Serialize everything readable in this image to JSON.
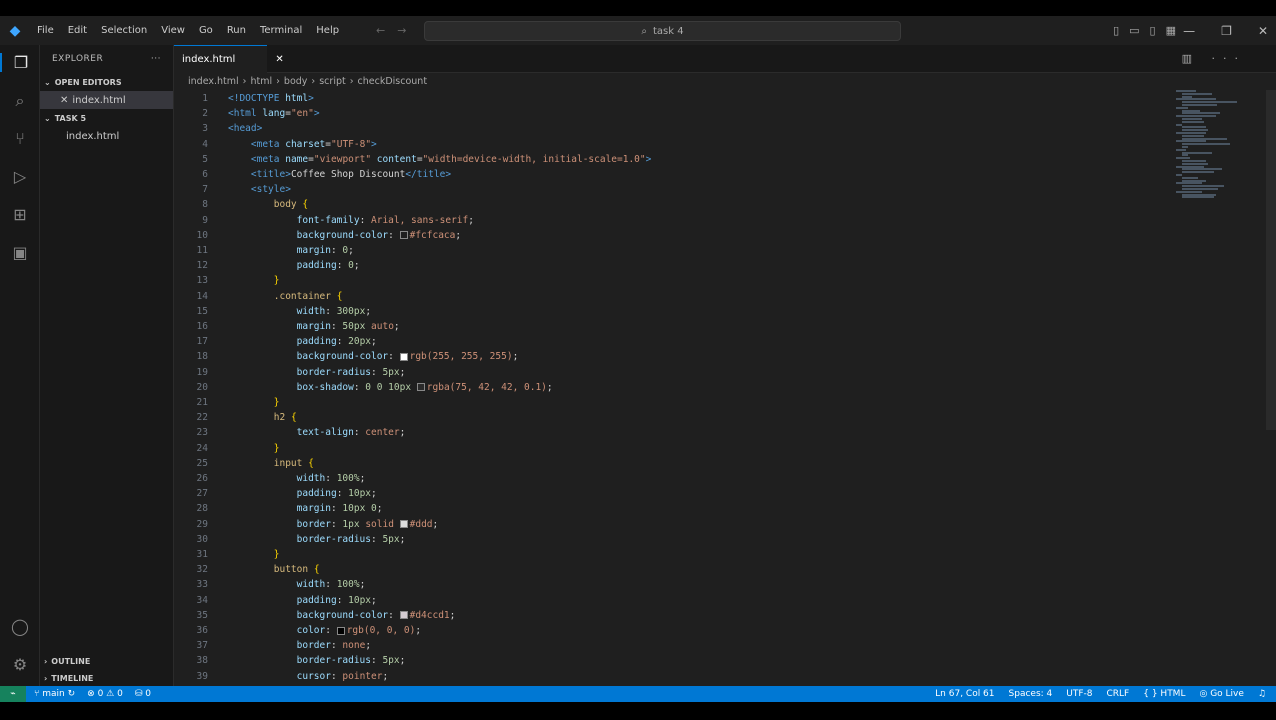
{
  "menu": [
    "File",
    "Edit",
    "Selection",
    "View",
    "Go",
    "Run",
    "Terminal",
    "Help"
  ],
  "search": {
    "text": "task 4"
  },
  "sidebar": {
    "title": "EXPLORER",
    "open_editors_label": "OPEN EDITORS",
    "open_editor_file": "index.html",
    "folder_label": "TASK 5",
    "folder_file": "index.html",
    "outline_label": "OUTLINE",
    "timeline_label": "TIMELINE"
  },
  "tab": {
    "label": "index.html",
    "close": "✕"
  },
  "breadcrumb": [
    "index.html",
    "html",
    "body",
    "script",
    "checkDiscount"
  ],
  "code_lines": [
    {
      "n": "1",
      "parts": [
        [
          "t-tag",
          "<!DOCTYPE "
        ],
        [
          "t-attr",
          "html"
        ],
        [
          "t-tag",
          ">"
        ]
      ]
    },
    {
      "n": "2",
      "parts": [
        [
          "t-tag",
          "<html "
        ],
        [
          "t-attr",
          "lang"
        ],
        [
          "t-punc",
          "="
        ],
        [
          "t-str",
          "\"en\""
        ],
        [
          "t-tag",
          ">"
        ]
      ]
    },
    {
      "n": "3",
      "parts": [
        [
          "t-tag",
          "<head>"
        ]
      ]
    },
    {
      "n": "4",
      "parts": [
        [
          "t-txt",
          "    "
        ],
        [
          "t-tag",
          "<meta "
        ],
        [
          "t-attr",
          "charset"
        ],
        [
          "t-punc",
          "="
        ],
        [
          "t-str",
          "\"UTF-8\""
        ],
        [
          "t-tag",
          ">"
        ]
      ]
    },
    {
      "n": "5",
      "parts": [
        [
          "t-txt",
          "    "
        ],
        [
          "t-tag",
          "<meta "
        ],
        [
          "t-attr",
          "name"
        ],
        [
          "t-punc",
          "="
        ],
        [
          "t-str",
          "\"viewport\" "
        ],
        [
          "t-attr",
          "content"
        ],
        [
          "t-punc",
          "="
        ],
        [
          "t-str",
          "\"width=device-width, initial-scale=1.0\""
        ],
        [
          "t-tag",
          ">"
        ]
      ]
    },
    {
      "n": "6",
      "parts": [
        [
          "t-txt",
          "    "
        ],
        [
          "t-tag",
          "<title>"
        ],
        [
          "t-txt",
          "Coffee Shop Discount"
        ],
        [
          "t-tag",
          "</title>"
        ]
      ]
    },
    {
      "n": "7",
      "parts": [
        [
          "t-txt",
          "    "
        ],
        [
          "t-tag",
          "<style>"
        ]
      ]
    },
    {
      "n": "8",
      "parts": [
        [
          "t-txt",
          "        "
        ],
        [
          "t-sel",
          "body "
        ],
        [
          "t-brk",
          "{"
        ]
      ]
    },
    {
      "n": "9",
      "parts": [
        [
          "t-txt",
          "            "
        ],
        [
          "t-prop",
          "font-family"
        ],
        [
          "t-punc",
          ": "
        ],
        [
          "t-val",
          "Arial, sans-serif"
        ],
        [
          "t-punc",
          ";"
        ]
      ]
    },
    {
      "n": "10",
      "parts": [
        [
          "t-txt",
          "            "
        ],
        [
          "t-prop",
          "background-color"
        ],
        [
          "t-punc",
          ": "
        ],
        [
          "swatch",
          "#fcfcaca"
        ],
        [
          "t-val",
          "#fcfcaca"
        ],
        [
          "t-punc",
          ";"
        ]
      ]
    },
    {
      "n": "11",
      "parts": [
        [
          "t-txt",
          "            "
        ],
        [
          "t-prop",
          "margin"
        ],
        [
          "t-punc",
          ": "
        ],
        [
          "t-num",
          "0"
        ],
        [
          "t-punc",
          ";"
        ]
      ]
    },
    {
      "n": "12",
      "parts": [
        [
          "t-txt",
          "            "
        ],
        [
          "t-prop",
          "padding"
        ],
        [
          "t-punc",
          ": "
        ],
        [
          "t-num",
          "0"
        ],
        [
          "t-punc",
          ";"
        ]
      ]
    },
    {
      "n": "13",
      "parts": [
        [
          "t-txt",
          "        "
        ],
        [
          "t-brk",
          "}"
        ]
      ]
    },
    {
      "n": "14",
      "parts": [
        [
          "t-txt",
          "        "
        ],
        [
          "t-sel",
          ".container "
        ],
        [
          "t-brk",
          "{"
        ]
      ]
    },
    {
      "n": "15",
      "parts": [
        [
          "t-txt",
          "            "
        ],
        [
          "t-prop",
          "width"
        ],
        [
          "t-punc",
          ": "
        ],
        [
          "t-num",
          "300px"
        ],
        [
          "t-punc",
          ";"
        ]
      ]
    },
    {
      "n": "16",
      "parts": [
        [
          "t-txt",
          "            "
        ],
        [
          "t-prop",
          "margin"
        ],
        [
          "t-punc",
          ": "
        ],
        [
          "t-num",
          "50px "
        ],
        [
          "t-val",
          "auto"
        ],
        [
          "t-punc",
          ";"
        ]
      ]
    },
    {
      "n": "17",
      "parts": [
        [
          "t-txt",
          "            "
        ],
        [
          "t-prop",
          "padding"
        ],
        [
          "t-punc",
          ": "
        ],
        [
          "t-num",
          "20px"
        ],
        [
          "t-punc",
          ";"
        ]
      ]
    },
    {
      "n": "18",
      "parts": [
        [
          "t-txt",
          "            "
        ],
        [
          "t-prop",
          "background-color"
        ],
        [
          "t-punc",
          ": "
        ],
        [
          "swatch",
          "#ffffff"
        ],
        [
          "t-val",
          "rgb(255, 255, 255)"
        ],
        [
          "t-punc",
          ";"
        ]
      ]
    },
    {
      "n": "19",
      "parts": [
        [
          "t-txt",
          "            "
        ],
        [
          "t-prop",
          "border-radius"
        ],
        [
          "t-punc",
          ": "
        ],
        [
          "t-num",
          "5px"
        ],
        [
          "t-punc",
          ";"
        ]
      ]
    },
    {
      "n": "20",
      "parts": [
        [
          "t-txt",
          "            "
        ],
        [
          "t-prop",
          "box-shadow"
        ],
        [
          "t-punc",
          ": "
        ],
        [
          "t-num",
          "0 0 10px "
        ],
        [
          "swatch",
          "#2a2a2a"
        ],
        [
          "t-val",
          "rgba(75, 42, 42, 0.1)"
        ],
        [
          "t-punc",
          ";"
        ]
      ]
    },
    {
      "n": "21",
      "parts": [
        [
          "t-txt",
          "        "
        ],
        [
          "t-brk",
          "}"
        ]
      ]
    },
    {
      "n": "22",
      "parts": [
        [
          "t-txt",
          "        "
        ],
        [
          "t-sel",
          "h2 "
        ],
        [
          "t-brk",
          "{"
        ]
      ]
    },
    {
      "n": "23",
      "parts": [
        [
          "t-txt",
          "            "
        ],
        [
          "t-prop",
          "text-align"
        ],
        [
          "t-punc",
          ": "
        ],
        [
          "t-val",
          "center"
        ],
        [
          "t-punc",
          ";"
        ]
      ]
    },
    {
      "n": "24",
      "parts": [
        [
          "t-txt",
          "        "
        ],
        [
          "t-brk",
          "}"
        ]
      ]
    },
    {
      "n": "25",
      "parts": [
        [
          "t-txt",
          "        "
        ],
        [
          "t-sel",
          "input "
        ],
        [
          "t-brk",
          "{"
        ]
      ]
    },
    {
      "n": "26",
      "parts": [
        [
          "t-txt",
          "            "
        ],
        [
          "t-prop",
          "width"
        ],
        [
          "t-punc",
          ": "
        ],
        [
          "t-num",
          "100%"
        ],
        [
          "t-punc",
          ";"
        ]
      ]
    },
    {
      "n": "27",
      "parts": [
        [
          "t-txt",
          "            "
        ],
        [
          "t-prop",
          "padding"
        ],
        [
          "t-punc",
          ": "
        ],
        [
          "t-num",
          "10px"
        ],
        [
          "t-punc",
          ";"
        ]
      ]
    },
    {
      "n": "28",
      "parts": [
        [
          "t-txt",
          "            "
        ],
        [
          "t-prop",
          "margin"
        ],
        [
          "t-punc",
          ": "
        ],
        [
          "t-num",
          "10px 0"
        ],
        [
          "t-punc",
          ";"
        ]
      ]
    },
    {
      "n": "29",
      "parts": [
        [
          "t-txt",
          "            "
        ],
        [
          "t-prop",
          "border"
        ],
        [
          "t-punc",
          ": "
        ],
        [
          "t-num",
          "1px "
        ],
        [
          "t-val",
          "solid "
        ],
        [
          "swatch",
          "#ddd"
        ],
        [
          "t-val",
          "#ddd"
        ],
        [
          "t-punc",
          ";"
        ]
      ]
    },
    {
      "n": "30",
      "parts": [
        [
          "t-txt",
          "            "
        ],
        [
          "t-prop",
          "border-radius"
        ],
        [
          "t-punc",
          ": "
        ],
        [
          "t-num",
          "5px"
        ],
        [
          "t-punc",
          ";"
        ]
      ]
    },
    {
      "n": "31",
      "parts": [
        [
          "t-txt",
          "        "
        ],
        [
          "t-brk",
          "}"
        ]
      ]
    },
    {
      "n": "32",
      "parts": [
        [
          "t-txt",
          "        "
        ],
        [
          "t-sel",
          "button "
        ],
        [
          "t-brk",
          "{"
        ]
      ]
    },
    {
      "n": "33",
      "parts": [
        [
          "t-txt",
          "            "
        ],
        [
          "t-prop",
          "width"
        ],
        [
          "t-punc",
          ": "
        ],
        [
          "t-num",
          "100%"
        ],
        [
          "t-punc",
          ";"
        ]
      ]
    },
    {
      "n": "34",
      "parts": [
        [
          "t-txt",
          "            "
        ],
        [
          "t-prop",
          "padding"
        ],
        [
          "t-punc",
          ": "
        ],
        [
          "t-num",
          "10px"
        ],
        [
          "t-punc",
          ";"
        ]
      ]
    },
    {
      "n": "35",
      "parts": [
        [
          "t-txt",
          "            "
        ],
        [
          "t-prop",
          "background-color"
        ],
        [
          "t-punc",
          ": "
        ],
        [
          "swatch",
          "#d4ccd1"
        ],
        [
          "t-val",
          "#d4ccd1"
        ],
        [
          "t-punc",
          ";"
        ]
      ]
    },
    {
      "n": "36",
      "parts": [
        [
          "t-txt",
          "            "
        ],
        [
          "t-prop",
          "color"
        ],
        [
          "t-punc",
          ": "
        ],
        [
          "swatch",
          "#000000"
        ],
        [
          "t-val",
          "rgb(0, 0, 0)"
        ],
        [
          "t-punc",
          ";"
        ]
      ]
    },
    {
      "n": "37",
      "parts": [
        [
          "t-txt",
          "            "
        ],
        [
          "t-prop",
          "border"
        ],
        [
          "t-punc",
          ": "
        ],
        [
          "t-val",
          "none"
        ],
        [
          "t-punc",
          ";"
        ]
      ]
    },
    {
      "n": "38",
      "parts": [
        [
          "t-txt",
          "            "
        ],
        [
          "t-prop",
          "border-radius"
        ],
        [
          "t-punc",
          ": "
        ],
        [
          "t-num",
          "5px"
        ],
        [
          "t-punc",
          ";"
        ]
      ]
    },
    {
      "n": "39",
      "parts": [
        [
          "t-txt",
          "            "
        ],
        [
          "t-prop",
          "cursor"
        ],
        [
          "t-punc",
          ": "
        ],
        [
          "t-val",
          "pointer"
        ],
        [
          "t-punc",
          ";"
        ]
      ]
    }
  ],
  "status": {
    "branch": "main",
    "problems": "0 ⚠ 0",
    "ports": "0",
    "position": "Ln 67, Col 61",
    "spaces": "Spaces: 4",
    "encoding": "UTF-8",
    "eol": "CRLF",
    "language": "HTML",
    "golive": "Go Live"
  },
  "colors": {
    "accent": "#0078d4",
    "remote": "#16825d",
    "editor_bg": "#1f1f1f"
  },
  "icons": [
    "files-icon",
    "search-icon",
    "source-control-icon",
    "run-debug-icon",
    "extensions-icon",
    "remote-icon",
    "account-icon",
    "settings-icon"
  ]
}
